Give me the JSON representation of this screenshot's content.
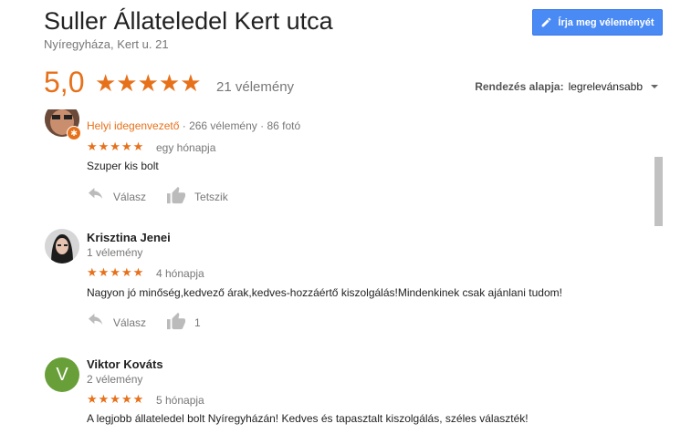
{
  "header": {
    "title": "Suller Állateledel Kert utca",
    "address": "Nyíregyháza, Kert u. 21",
    "write_review_label": "Írja meg véleményét",
    "rating": "5,0",
    "stars": "★★★★★",
    "review_count": "21 vélemény"
  },
  "sort": {
    "label": "Rendezés alapja:",
    "value": "legrelevánsabb"
  },
  "reviews": [
    {
      "guide_label": "Helyi idegenvezető",
      "meta": " · 266 vélemény · 86 fotó",
      "stars": "★★★★★",
      "date": "egy hónapja",
      "text": "Szuper kis bolt",
      "reply_label": "Válasz",
      "like_label": "Tetszik"
    },
    {
      "author": "Krisztina Jenei",
      "author_meta": "1 vélemény",
      "stars": "★★★★★",
      "date": "4 hónapja",
      "text": "Nagyon jó minőség,kedvező árak,kedves-hozzáértő kiszolgálás!Mindenkinek csak ajánlani tudom!",
      "reply_label": "Válasz",
      "like_label": "1"
    },
    {
      "author": "Viktor Kováts",
      "author_meta": "2 vélemény",
      "avatar_letter": "V",
      "stars": "★★★★★",
      "date": "5 hónapja",
      "text": "A legjobb állateledel bolt Nyíregyházán! Kedves és tapasztalt kiszolgálás, széles választék!"
    }
  ],
  "colors": {
    "accent": "#e7711b",
    "button": "#4a8af4",
    "avatar_v": "#689f38"
  }
}
